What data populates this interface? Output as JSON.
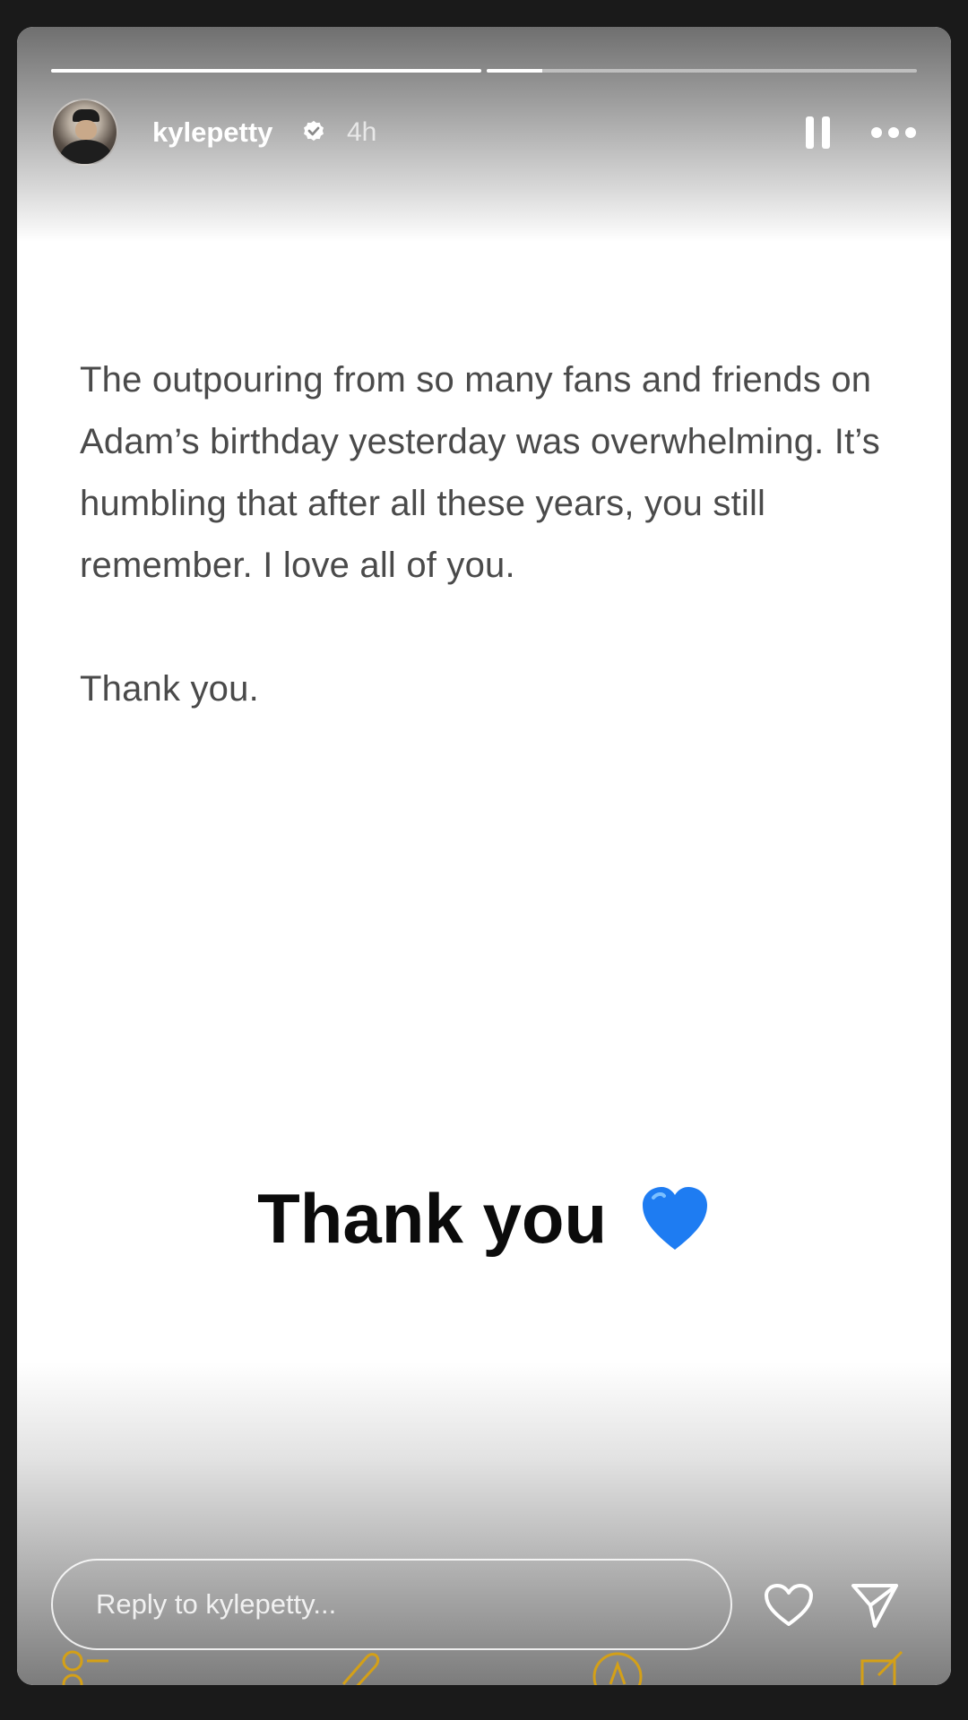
{
  "story": {
    "progress": [
      1.0,
      0.13
    ],
    "user": {
      "username": "kylepetty",
      "verified": true,
      "time_ago": "4h",
      "avatar_icon": "profile-photo"
    },
    "controls": {
      "pause_icon": "pause-icon",
      "more_icon": "more-options-icon"
    },
    "note": {
      "paragraph1": "The outpouring from so many fans and friends on Adam’s birthday yesterday was overwhelming. It’s humbling that after all these years, you still remember. I love all of you.",
      "paragraph2": "Thank you."
    },
    "sticker": {
      "text": "Thank you",
      "emoji_icon": "blue-heart-icon",
      "emoji_color": "#1e7cf2"
    },
    "footer": {
      "reply_placeholder": "Reply to kylepetty...",
      "like_icon": "heart-outline-icon",
      "share_icon": "send-icon"
    },
    "background_toolbar_icons": [
      "checklist-icon",
      "attachment-icon",
      "markup-icon",
      "compose-icon"
    ],
    "accent_color": "#d4a017"
  }
}
